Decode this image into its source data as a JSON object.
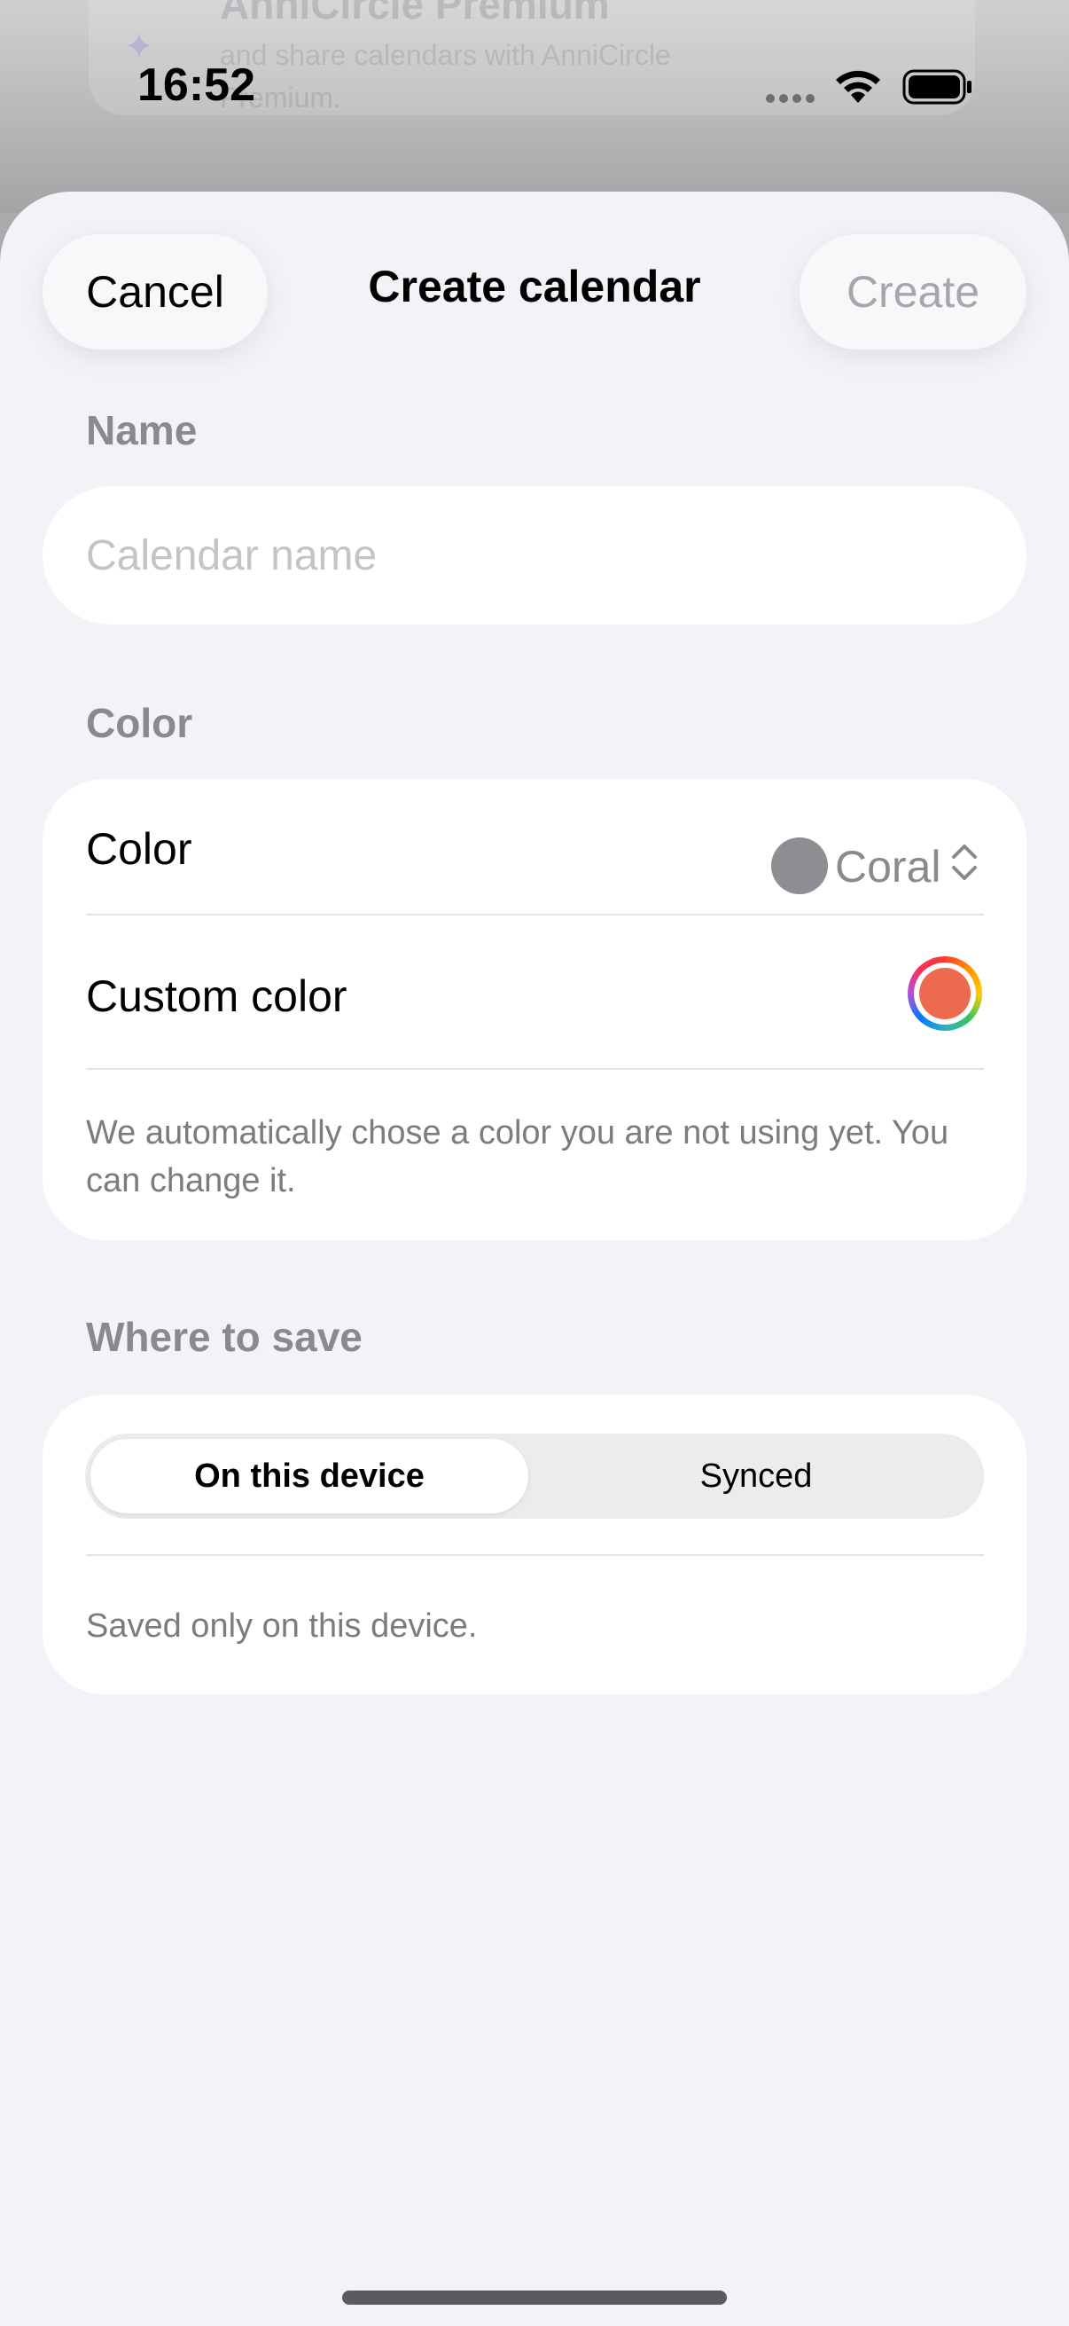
{
  "background_app": {
    "title": "AnniCircle Premium",
    "subtitle": "and share calendars with AnniCircle Premium."
  },
  "status_bar": {
    "time": "16:52",
    "icons": [
      "cellular-signal-icon",
      "wifi-icon",
      "battery-icon"
    ]
  },
  "sheet": {
    "title": "Create calendar",
    "cancel_label": "Cancel",
    "create_label": "Create"
  },
  "name_section": {
    "label": "Name",
    "value": "",
    "placeholder": "Calendar name"
  },
  "color_section": {
    "label": "Color",
    "color_row_label": "Color",
    "selected_color": "Coral",
    "swatch_color": "#8e8e92",
    "custom_color_label": "Custom color",
    "custom_color_value": "#ee6a4e",
    "footnote": "We automatically chose a color you are not using yet. You can change it."
  },
  "save_section": {
    "label": "Where to save",
    "options": [
      "On this device",
      "Synced"
    ],
    "selected": "On this device",
    "footnote": "Saved only on this device."
  },
  "colors": {
    "sheet_bg": "#f2f2f7",
    "disabled_text": "#a7a7ab",
    "secondary_text": "#8a8a8e"
  }
}
